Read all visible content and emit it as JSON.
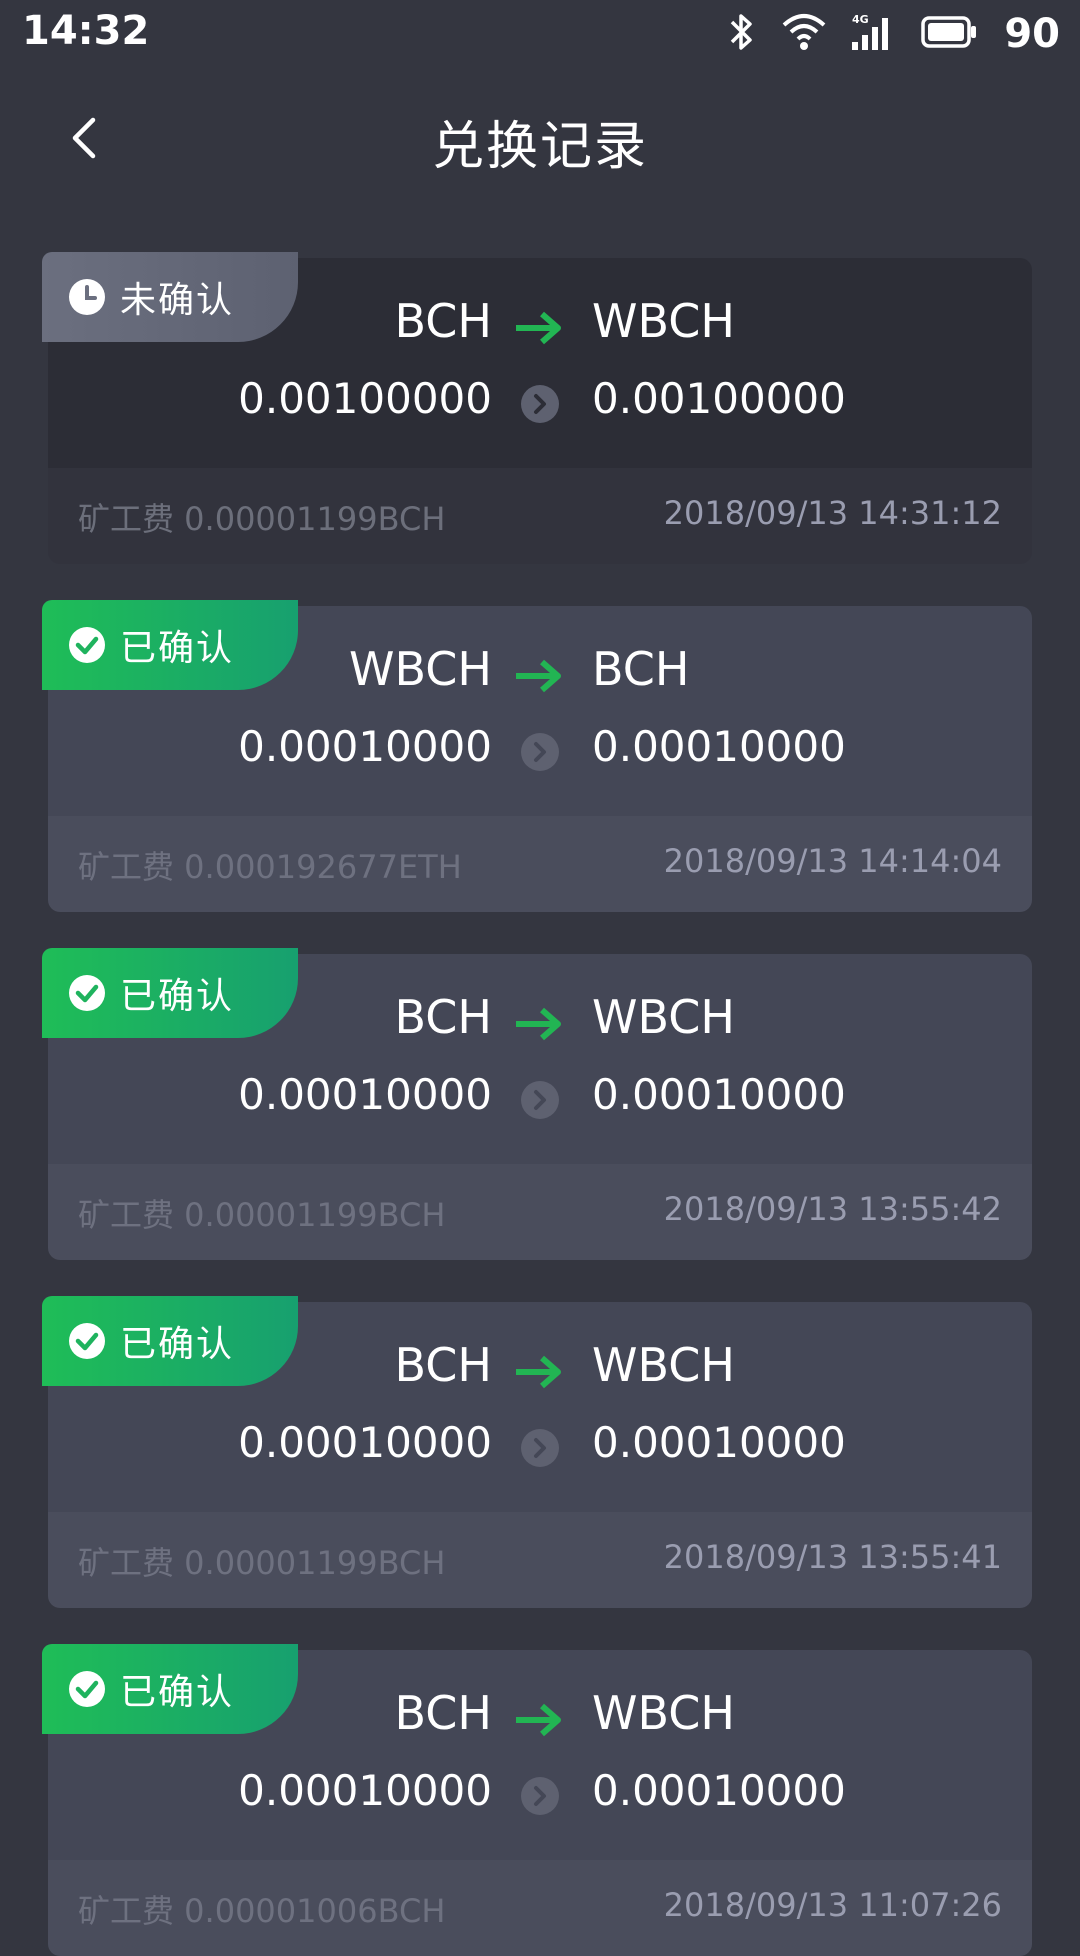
{
  "status_bar": {
    "time": "14:32",
    "network": "4G",
    "battery": "90",
    "icons": [
      "bluetooth-icon",
      "wifi-icon",
      "signal-icon",
      "battery-icon"
    ]
  },
  "nav": {
    "back_icon": "chevron-left-icon",
    "title": "兑换记录"
  },
  "colors": {
    "background": "#343640",
    "pending_badge": "#6b6f7f",
    "confirmed_badge": "#1fbd57",
    "arrow": "#22b553"
  },
  "records": [
    {
      "status": "未确认",
      "status_type": "pending",
      "from_coin": "BCH",
      "to_coin": "WBCH",
      "from_amount": "0.00100000",
      "to_amount": "0.00100000",
      "fee": "矿工费 0.00001199BCH",
      "time": "2018/09/13 14:31:12"
    },
    {
      "status": "已确认",
      "status_type": "confirmed",
      "from_coin": "WBCH",
      "to_coin": "BCH",
      "from_amount": "0.00010000",
      "to_amount": "0.00010000",
      "fee": "矿工费 0.000192677ETH",
      "time": "2018/09/13 14:14:04"
    },
    {
      "status": "已确认",
      "status_type": "confirmed",
      "from_coin": "BCH",
      "to_coin": "WBCH",
      "from_amount": "0.00010000",
      "to_amount": "0.00010000",
      "fee": "矿工费 0.00001199BCH",
      "time": "2018/09/13 13:55:42"
    },
    {
      "status": "已确认",
      "status_type": "confirmed",
      "from_coin": "BCH",
      "to_coin": "WBCH",
      "from_amount": "0.00010000",
      "to_amount": "0.00010000",
      "fee": "矿工费 0.00001199BCH",
      "time": "2018/09/13 13:55:41"
    },
    {
      "status": "已确认",
      "status_type": "confirmed",
      "from_coin": "BCH",
      "to_coin": "WBCH",
      "from_amount": "0.00010000",
      "to_amount": "0.00010000",
      "fee": "矿工费 0.00001006BCH",
      "time": "2018/09/13 11:07:26"
    }
  ]
}
